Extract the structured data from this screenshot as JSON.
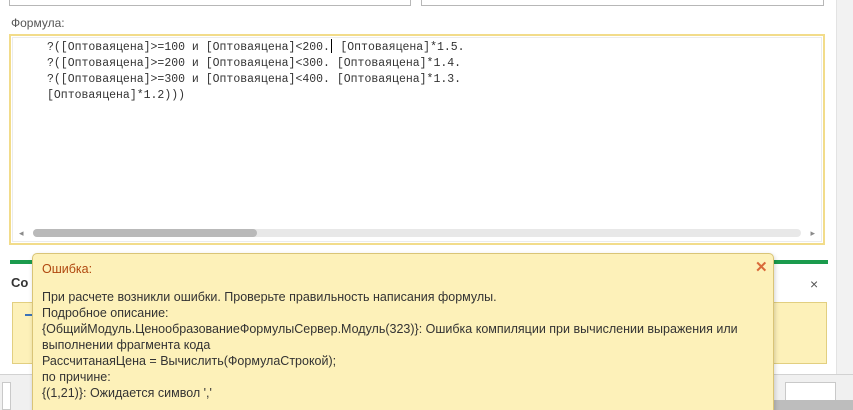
{
  "formula": {
    "label": "Формула:",
    "lines": [
      "?([Оптоваяцена]>=100 и [Оптоваяцена]<200.",
      " [Оптоваяцена]*1.5.",
      "?([Оптоваяцена]>=200 и [Оптоваяцена]<300. [Оптоваяцена]*1.4.",
      "?([Оптоваяцена]>=300 и [Оптоваяцена]<400. [Оптоваяцена]*1.3.",
      "[Оптоваяцена]*1.2)))"
    ],
    "scroll_left_arrow": "◂",
    "scroll_right_arrow": "▸"
  },
  "panel": {
    "title": "Со",
    "close_icon": "×"
  },
  "error_tooltip": {
    "title": "Ошибка:",
    "close_icon": "✕",
    "lines": [
      "При расчете возникли ошибки. Проверьте правильность написания формулы.",
      "Подробное описание:",
      "{ОбщийМодуль.ЦенообразованиеФормулыСервер.Модуль(323)}: Ошибка компиляции при вычислении выражения или",
      "выполнении фрагмента кода",
      "РассчитанаяЦена = Вычислить(ФормулаСтрокой);",
      "по причине:",
      "{(1,21)}: Ожидается символ ','"
    ],
    "colors": {
      "background": "#fdf1b9",
      "title": "#b0480f",
      "close": "#d96a3a"
    }
  }
}
